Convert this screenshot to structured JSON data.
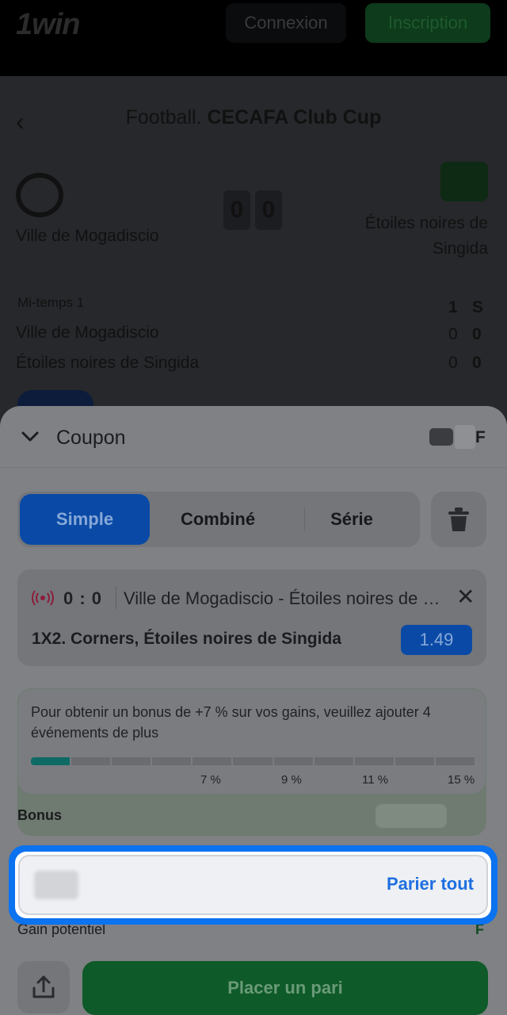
{
  "header": {
    "logo": "1win",
    "login_label": "Connexion",
    "signup_label": "Inscription"
  },
  "match": {
    "sport": "Football.",
    "competition": "CECAFA Club Cup",
    "home_team": "Ville de Mogadiscio",
    "away_team_line1": "Étoiles noires de",
    "away_team_line2": "Singida",
    "home_score": "0",
    "away_score": "0",
    "period": "Mi-temps 1",
    "col1": "1",
    "col2": "S",
    "home_name_row": "Ville de Mogadiscio",
    "away_name_row": "Étoiles noires de Singida",
    "home_c1": "0",
    "home_c2": "0",
    "away_c1": "0",
    "away_c2": "0"
  },
  "coupon": {
    "title": "Coupon",
    "currency": "F",
    "tabs": [
      {
        "label": "Simple",
        "active": true
      },
      {
        "label": "Combiné",
        "active": false
      },
      {
        "label": "Série",
        "active": false
      }
    ],
    "bet": {
      "score": "0 : 0",
      "match": "Ville de Mogadiscio - Étoiles noires de Singida",
      "market": "1X2. Corners, Étoiles noires de Singida",
      "odds": "1.49"
    },
    "bonus": {
      "message": "Pour obtenir un bonus de +7 % sur vos gains, veuillez ajouter 4 événements de plus",
      "progress_filled_segments": 1,
      "total_segments": 11,
      "markers": [
        "7 %",
        "9 %",
        "11 %",
        "15 %"
      ],
      "label": "Bonus"
    },
    "stake": {
      "bet_all_label": "Parier tout"
    },
    "potential_gain_label": "Gain potentiel",
    "potential_gain_currency": "F",
    "place_bet_label": "Placer un pari"
  },
  "colors": {
    "accent_blue": "#0b72f0",
    "place_green": "#0e5a28",
    "bonus_teal": "#0e6a64"
  }
}
